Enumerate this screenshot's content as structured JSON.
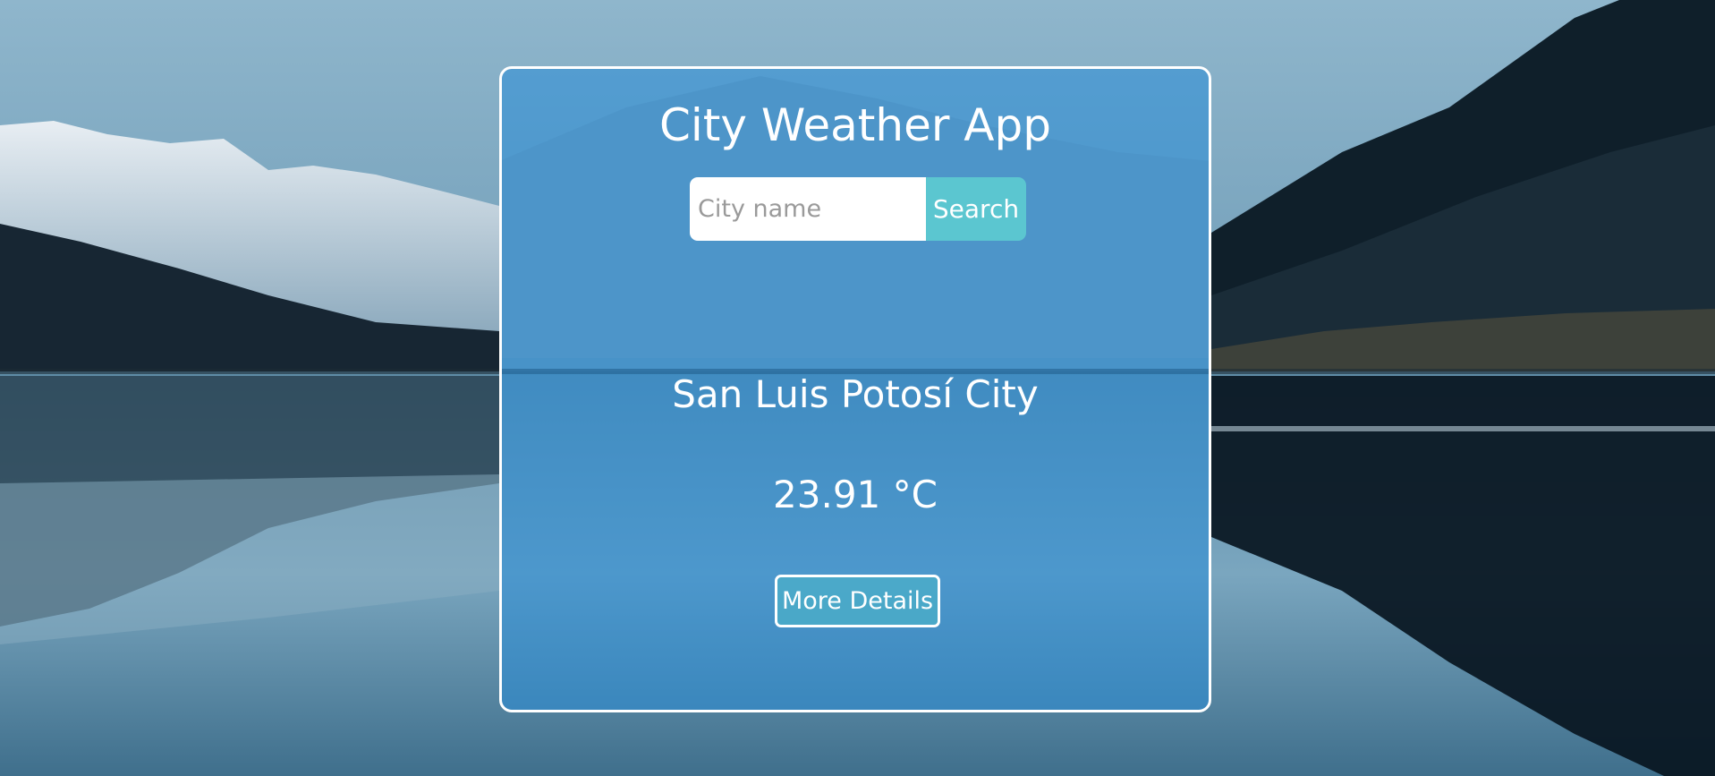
{
  "app": {
    "title": "City Weather App"
  },
  "search": {
    "placeholder": "City name",
    "value": "",
    "button_label": "Search"
  },
  "weather": {
    "city": "San Luis Potosí City",
    "temperature": "23.91 °C"
  },
  "actions": {
    "details_label": "More Details"
  },
  "colors": {
    "card_border": "#ffffff",
    "search_button": "#5bc6d0",
    "text": "#ffffff"
  },
  "background": {
    "scene": "mountain-lake-reflection"
  }
}
